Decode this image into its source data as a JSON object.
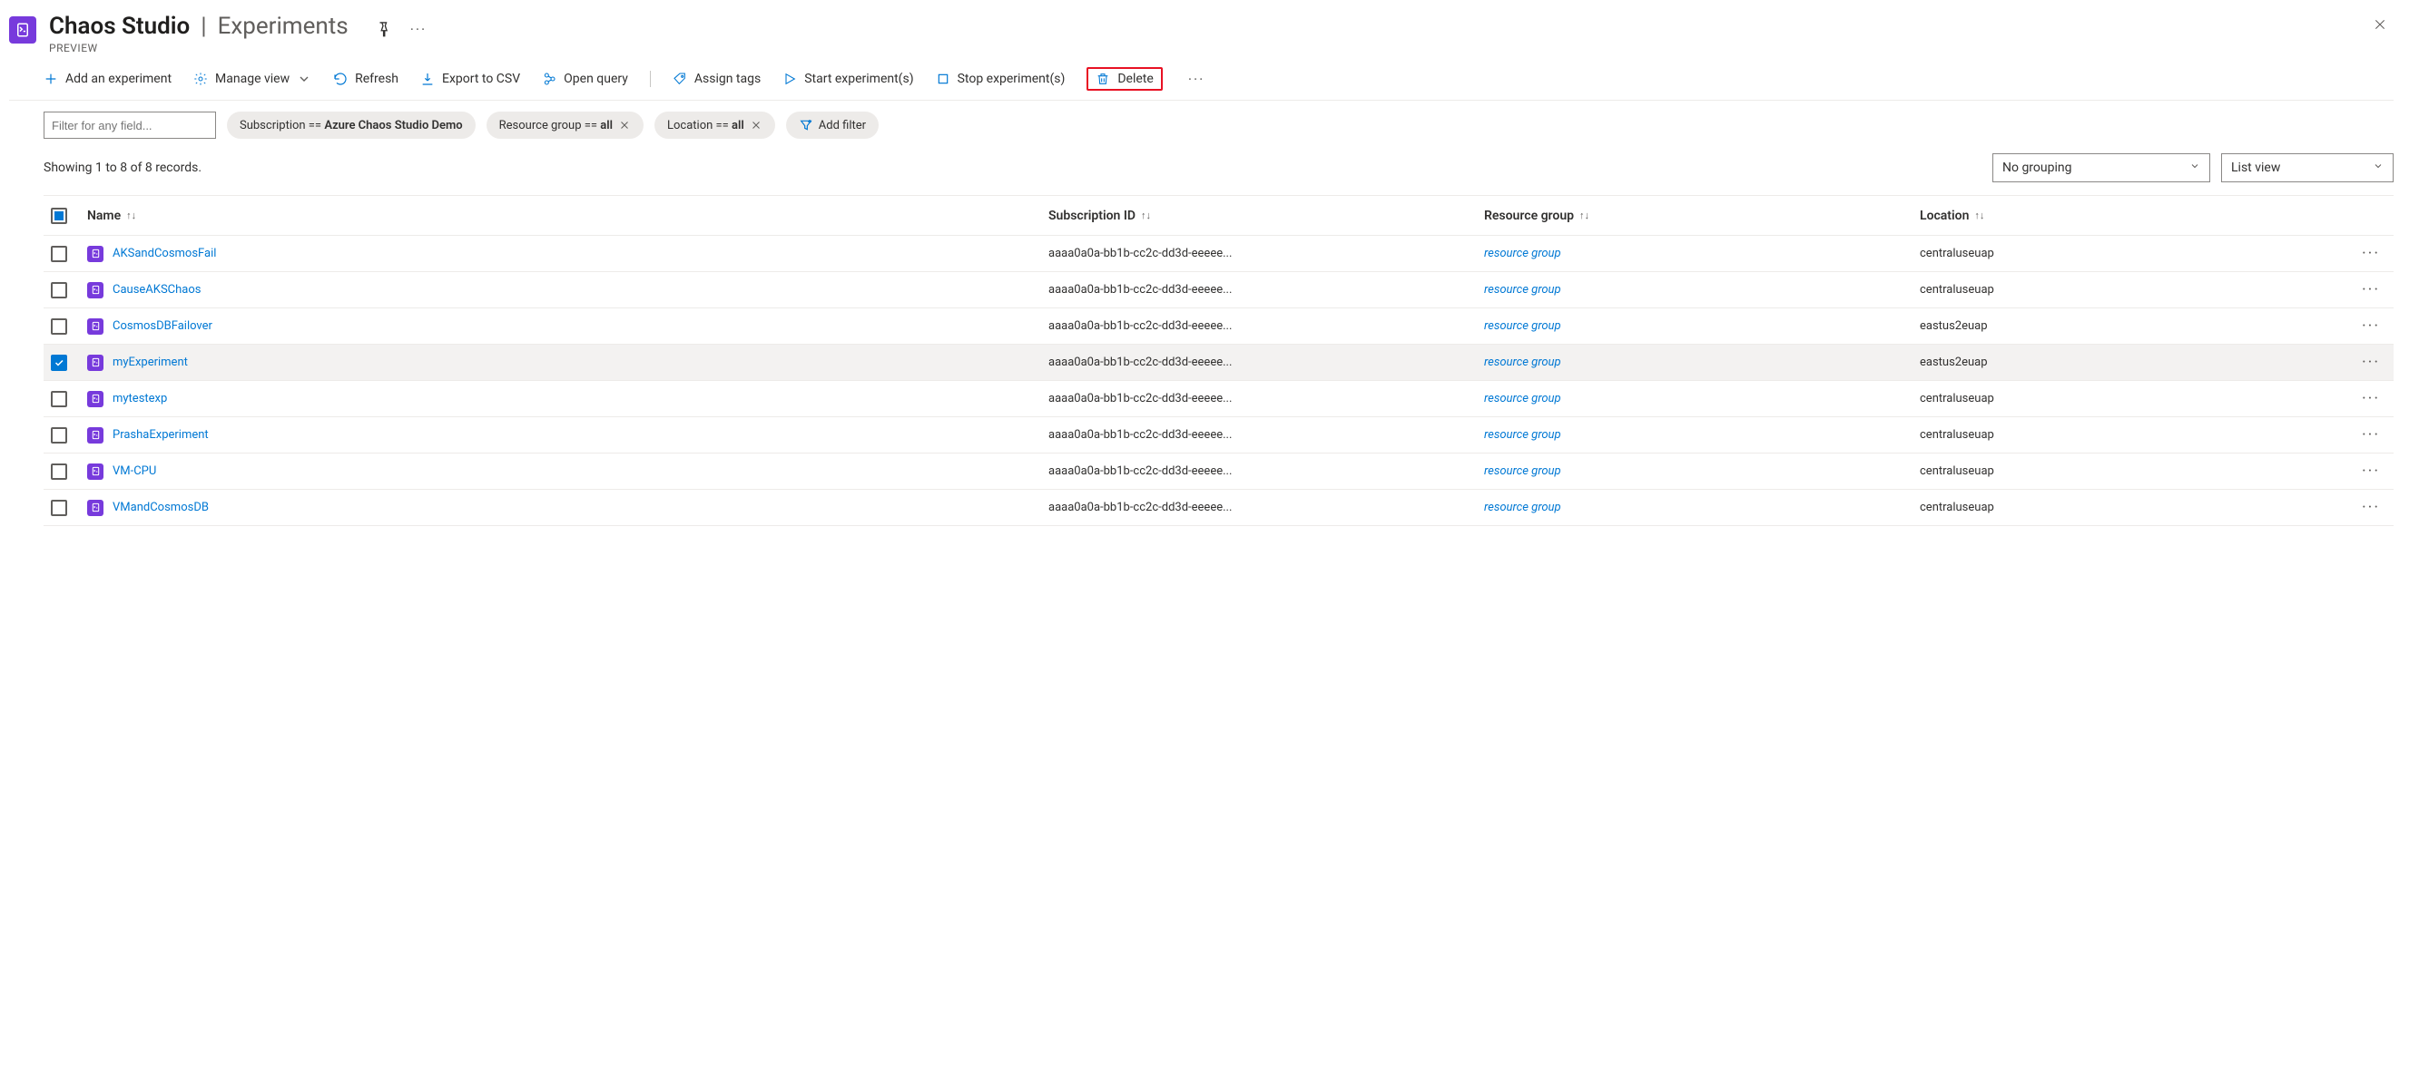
{
  "header": {
    "service": "Chaos Studio",
    "page": "Experiments",
    "preview": "PREVIEW"
  },
  "toolbar": {
    "add": "Add an experiment",
    "manage_view": "Manage view",
    "refresh": "Refresh",
    "export": "Export to CSV",
    "open_query": "Open query",
    "assign_tags": "Assign tags",
    "start": "Start experiment(s)",
    "stop": "Stop experiment(s)",
    "delete": "Delete"
  },
  "filters": {
    "placeholder": "Filter for any field...",
    "subscription_label": "Subscription ==",
    "subscription_value": "Azure Chaos Studio Demo",
    "rg_label": "Resource group ==",
    "rg_value": "all",
    "location_label": "Location ==",
    "location_value": "all",
    "add_filter": "Add filter"
  },
  "status": "Showing 1 to 8 of 8 records.",
  "grouping_value": "No grouping",
  "view_value": "List view",
  "columns": {
    "name": "Name",
    "subscription": "Subscription ID",
    "resource_group": "Resource group",
    "location": "Location"
  },
  "rg_display": "resource group",
  "rows": [
    {
      "name": "AKSandCosmosFail",
      "sub": "aaaa0a0a-bb1b-cc2c-dd3d-eeeee...",
      "loc": "centraluseuap",
      "selected": false
    },
    {
      "name": "CauseAKSChaos",
      "sub": "aaaa0a0a-bb1b-cc2c-dd3d-eeeee...",
      "loc": "centraluseuap",
      "selected": false
    },
    {
      "name": "CosmosDBFailover",
      "sub": "aaaa0a0a-bb1b-cc2c-dd3d-eeeee...",
      "loc": "eastus2euap",
      "selected": false
    },
    {
      "name": "myExperiment",
      "sub": "aaaa0a0a-bb1b-cc2c-dd3d-eeeee...",
      "loc": "eastus2euap",
      "selected": true
    },
    {
      "name": "mytestexp",
      "sub": "aaaa0a0a-bb1b-cc2c-dd3d-eeeee...",
      "loc": "centraluseuap",
      "selected": false
    },
    {
      "name": "PrashaExperiment",
      "sub": "aaaa0a0a-bb1b-cc2c-dd3d-eeeee...",
      "loc": "centraluseuap",
      "selected": false
    },
    {
      "name": "VM-CPU",
      "sub": "aaaa0a0a-bb1b-cc2c-dd3d-eeeee...",
      "loc": "centraluseuap",
      "selected": false
    },
    {
      "name": "VMandCosmosDB",
      "sub": "aaaa0a0a-bb1b-cc2c-dd3d-eeeee...",
      "loc": "centraluseuap",
      "selected": false
    }
  ]
}
